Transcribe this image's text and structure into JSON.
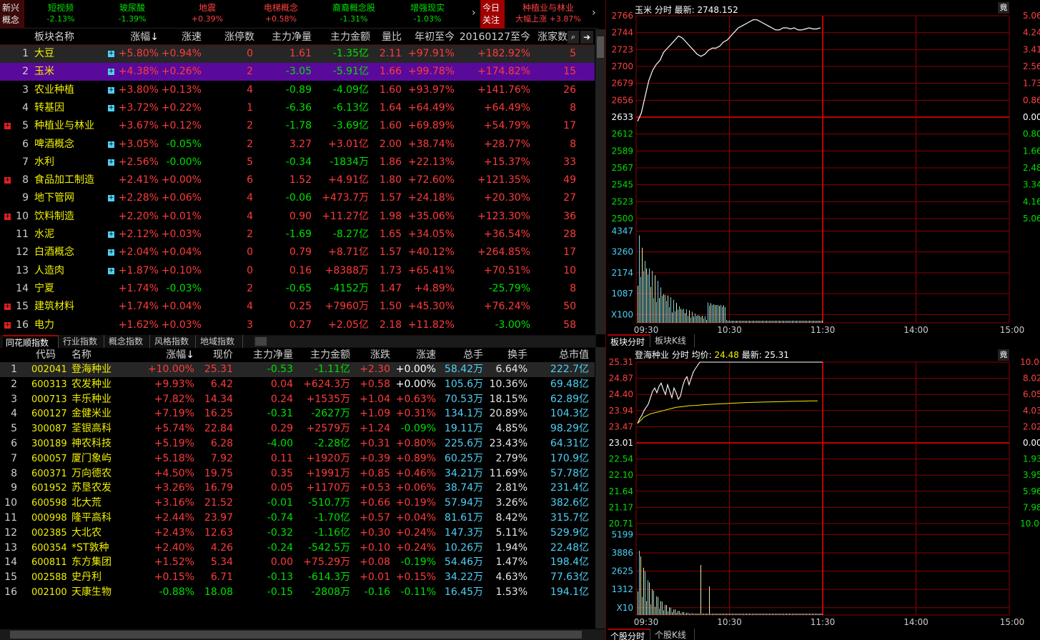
{
  "ticker": {
    "left_label_1": "新兴",
    "left_label_2": "概念",
    "items": [
      {
        "name": "短视频",
        "value": "-2.13%",
        "name_color": "green",
        "value_color": "green"
      },
      {
        "name": "玻尿酸",
        "value": "-1.39%",
        "name_color": "green",
        "value_color": "green"
      },
      {
        "name": "地震",
        "value": "+0.39%",
        "name_color": "red",
        "value_color": "red"
      },
      {
        "name": "电梯概念",
        "value": "+0.58%",
        "name_color": "red",
        "value_color": "red"
      },
      {
        "name": "裔裔概念股",
        "value": "-1.31%",
        "name_color": "green",
        "value_color": "green"
      },
      {
        "name": "增强现实",
        "value": "-1.03%",
        "name_color": "green",
        "value_color": "green"
      }
    ],
    "arrow": "›",
    "focus_label_1": "今日",
    "focus_label_2": "关注",
    "focus_item_title": "种植业与林业",
    "focus_item_desc": "大幅上涨 +3.87%"
  },
  "sector_table": {
    "columns": [
      "板块名称",
      "涨幅",
      "涨速",
      "涨停数",
      "主力净量",
      "主力金额",
      "量比",
      "年初至今",
      "20160127至今",
      "涨家数"
    ],
    "sort_arrow": "↓",
    "rows": [
      {
        "i": "1",
        "name": "大豆",
        "icon": "cyan",
        "chg": "+5.80%",
        "spd": "+0.94%",
        "lim": "0",
        "net": "1.61",
        "amt": "-1.35亿",
        "vr": "2.11",
        "ytd": "+97.91%",
        "since": "+182.92%",
        "ups": "5"
      },
      {
        "i": "2",
        "name": "玉米",
        "icon": "cyan",
        "chg": "+4.38%",
        "spd": "+0.26%",
        "lim": "2",
        "net": "-3.05",
        "amt": "-5.91亿",
        "vr": "1.66",
        "ytd": "+99.78%",
        "since": "+174.82%",
        "ups": "15"
      },
      {
        "i": "3",
        "name": "农业种植",
        "icon": "cyan",
        "chg": "+3.80%",
        "spd": "+0.13%",
        "lim": "4",
        "net": "-0.89",
        "amt": "-4.09亿",
        "vr": "1.60",
        "ytd": "+93.97%",
        "since": "+141.76%",
        "ups": "26"
      },
      {
        "i": "4",
        "name": "转基因",
        "icon": "cyan",
        "chg": "+3.72%",
        "spd": "+0.22%",
        "lim": "1",
        "net": "-6.36",
        "amt": "-6.13亿",
        "vr": "1.64",
        "ytd": "+64.49%",
        "since": "+64.49%",
        "ups": "8"
      },
      {
        "i": "5",
        "name": "种植业与林业",
        "icon": "red",
        "chg": "+3.67%",
        "spd": "+0.12%",
        "lim": "2",
        "net": "-1.78",
        "amt": "-3.69亿",
        "vr": "1.60",
        "ytd": "+69.89%",
        "since": "+54.79%",
        "ups": "17"
      },
      {
        "i": "6",
        "name": "啤酒概念",
        "icon": "cyan",
        "chg": "+3.05%",
        "spd": "-0.05%",
        "lim": "2",
        "net": "3.27",
        "amt": "+3.01亿",
        "vr": "2.00",
        "ytd": "+38.74%",
        "since": "+28.77%",
        "ups": "8"
      },
      {
        "i": "7",
        "name": "水利",
        "icon": "cyan",
        "chg": "+2.56%",
        "spd": "-0.00%",
        "lim": "5",
        "net": "-0.34",
        "amt": "-1834万",
        "vr": "1.86",
        "ytd": "+22.13%",
        "since": "+15.37%",
        "ups": "33"
      },
      {
        "i": "8",
        "name": "食品加工制造",
        "icon": "red",
        "chg": "+2.41%",
        "spd": "+0.00%",
        "lim": "6",
        "net": "1.52",
        "amt": "+4.91亿",
        "vr": "1.80",
        "ytd": "+72.60%",
        "since": "+121.35%",
        "ups": "49"
      },
      {
        "i": "9",
        "name": "地下管网",
        "icon": "cyan",
        "chg": "+2.28%",
        "spd": "+0.06%",
        "lim": "4",
        "net": "-0.06",
        "amt": "+473.7万",
        "vr": "1.57",
        "ytd": "+24.18%",
        "since": "+20.30%",
        "ups": "27"
      },
      {
        "i": "10",
        "name": "饮料制造",
        "icon": "red",
        "chg": "+2.20%",
        "spd": "+0.01%",
        "lim": "4",
        "net": "0.90",
        "amt": "+11.27亿",
        "vr": "1.98",
        "ytd": "+35.06%",
        "since": "+123.30%",
        "ups": "36"
      },
      {
        "i": "11",
        "name": "水泥",
        "icon": "cyan",
        "chg": "+2.12%",
        "spd": "+0.03%",
        "lim": "2",
        "net": "-1.69",
        "amt": "-8.27亿",
        "vr": "1.65",
        "ytd": "+34.05%",
        "since": "+36.54%",
        "ups": "28"
      },
      {
        "i": "12",
        "name": "白酒概念",
        "icon": "cyan",
        "chg": "+2.04%",
        "spd": "+0.04%",
        "lim": "0",
        "net": "0.79",
        "amt": "+8.71亿",
        "vr": "1.57",
        "ytd": "+40.12%",
        "since": "+264.85%",
        "ups": "17"
      },
      {
        "i": "13",
        "name": "人造肉",
        "icon": "cyan",
        "chg": "+1.87%",
        "spd": "+0.10%",
        "lim": "0",
        "net": "0.16",
        "amt": "+8388万",
        "vr": "1.73",
        "ytd": "+65.41%",
        "since": "+70.51%",
        "ups": "10"
      },
      {
        "i": "14",
        "name": "宁夏",
        "icon": "",
        "chg": "+1.74%",
        "spd": "-0.03%",
        "lim": "2",
        "net": "-0.65",
        "amt": "-4152万",
        "vr": "1.47",
        "ytd": "+4.89%",
        "since": "-25.79%",
        "ups": "8"
      },
      {
        "i": "15",
        "name": "建筑材料",
        "icon": "red",
        "chg": "+1.74%",
        "spd": "+0.04%",
        "lim": "4",
        "net": "0.25",
        "amt": "+7960万",
        "vr": "1.50",
        "ytd": "+45.30%",
        "since": "+76.24%",
        "ups": "50"
      },
      {
        "i": "16",
        "name": "电力",
        "icon": "red",
        "chg": "+1.62%",
        "spd": "+0.03%",
        "lim": "3",
        "net": "0.27",
        "amt": "+2.05亿",
        "vr": "2.18",
        "ytd": "+11.82%",
        "since": "-3.00%",
        "ups": "58"
      }
    ]
  },
  "index_tabs": [
    "同花顺指数",
    "行业指数",
    "概念指数",
    "风格指数",
    "地域指数"
  ],
  "stock_table": {
    "columns": [
      "代码",
      "名称",
      "涨幅",
      "现价",
      "主力净量",
      "主力金额",
      "涨跌",
      "涨速",
      "总手",
      "换手",
      "总市值"
    ],
    "rows": [
      {
        "i": "1",
        "code": "002041",
        "name": "登海种业",
        "chg": "+10.00%",
        "price": "25.31",
        "net": "-0.53",
        "amt": "-1.11亿",
        "diff": "+2.30",
        "spd": "+0.00%",
        "vol": "58.42万",
        "turn": "6.64%",
        "cap": "222.7亿"
      },
      {
        "i": "2",
        "code": "600313",
        "name": "农发种业",
        "chg": "+9.93%",
        "price": "6.42",
        "net": "0.04",
        "amt": "+624.3万",
        "diff": "+0.58",
        "spd": "+0.00%",
        "vol": "105.6万",
        "turn": "10.36%",
        "cap": "69.48亿"
      },
      {
        "i": "3",
        "code": "000713",
        "name": "丰乐种业",
        "chg": "+7.82%",
        "price": "14.34",
        "net": "0.24",
        "amt": "+1535万",
        "diff": "+1.04",
        "spd": "+0.63%",
        "vol": "70.53万",
        "turn": "18.15%",
        "cap": "62.89亿"
      },
      {
        "i": "4",
        "code": "600127",
        "name": "金健米业",
        "chg": "+7.19%",
        "price": "16.25",
        "net": "-0.31",
        "amt": "-2627万",
        "diff": "+1.09",
        "spd": "+0.31%",
        "vol": "134.1万",
        "turn": "20.89%",
        "cap": "104.3亿"
      },
      {
        "i": "5",
        "code": "300087",
        "name": "荃银高科",
        "chg": "+5.74%",
        "price": "22.84",
        "net": "0.29",
        "amt": "+2579万",
        "diff": "+1.24",
        "spd": "-0.09%",
        "vol": "19.11万",
        "turn": "4.85%",
        "cap": "98.29亿"
      },
      {
        "i": "6",
        "code": "300189",
        "name": "神农科技",
        "chg": "+5.19%",
        "price": "6.28",
        "net": "-4.00",
        "amt": "-2.28亿",
        "diff": "+0.31",
        "spd": "+0.80%",
        "vol": "225.6万",
        "turn": "23.43%",
        "cap": "64.31亿"
      },
      {
        "i": "7",
        "code": "600057",
        "name": "厦门象屿",
        "chg": "+5.18%",
        "price": "7.92",
        "net": "0.11",
        "amt": "+1920万",
        "diff": "+0.39",
        "spd": "+0.89%",
        "vol": "60.25万",
        "turn": "2.79%",
        "cap": "170.9亿"
      },
      {
        "i": "8",
        "code": "600371",
        "name": "万向德农",
        "chg": "+4.50%",
        "price": "19.75",
        "net": "0.35",
        "amt": "+1991万",
        "diff": "+0.85",
        "spd": "+0.46%",
        "vol": "34.21万",
        "turn": "11.69%",
        "cap": "57.78亿"
      },
      {
        "i": "9",
        "code": "601952",
        "name": "苏垦农发",
        "chg": "+3.26%",
        "price": "16.79",
        "net": "0.05",
        "amt": "+1170万",
        "diff": "+0.53",
        "spd": "+0.06%",
        "vol": "38.74万",
        "turn": "2.81%",
        "cap": "231.4亿"
      },
      {
        "i": "10",
        "code": "600598",
        "name": "北大荒",
        "chg": "+3.16%",
        "price": "21.52",
        "net": "-0.01",
        "amt": "-510.7万",
        "diff": "+0.66",
        "spd": "+0.19%",
        "vol": "57.94万",
        "turn": "3.26%",
        "cap": "382.6亿"
      },
      {
        "i": "11",
        "code": "000998",
        "name": "隆平高科",
        "chg": "+2.44%",
        "price": "23.97",
        "net": "-0.74",
        "amt": "-1.70亿",
        "diff": "+0.57",
        "spd": "+0.04%",
        "vol": "81.61万",
        "turn": "8.42%",
        "cap": "315.7亿"
      },
      {
        "i": "12",
        "code": "002385",
        "name": "大北农",
        "chg": "+2.43%",
        "price": "12.63",
        "net": "-0.32",
        "amt": "-1.16亿",
        "diff": "+0.30",
        "spd": "+0.24%",
        "vol": "147.3万",
        "turn": "5.11%",
        "cap": "529.9亿"
      },
      {
        "i": "13",
        "code": "600354",
        "name": "*ST敦种",
        "chg": "+2.40%",
        "price": "4.26",
        "net": "-0.24",
        "amt": "-542.5万",
        "diff": "+0.10",
        "spd": "+0.24%",
        "vol": "10.26万",
        "turn": "1.94%",
        "cap": "22.48亿"
      },
      {
        "i": "14",
        "code": "600811",
        "name": "东方集团",
        "chg": "+1.52%",
        "price": "5.34",
        "net": "0.00",
        "amt": "+75.29万",
        "diff": "+0.08",
        "spd": "-0.19%",
        "vol": "54.46万",
        "turn": "1.47%",
        "cap": "198.4亿"
      },
      {
        "i": "15",
        "code": "002588",
        "name": "史丹利",
        "chg": "+0.15%",
        "price": "6.71",
        "net": "-0.13",
        "amt": "-614.3万",
        "diff": "+0.01",
        "spd": "+0.15%",
        "vol": "34.22万",
        "turn": "4.63%",
        "cap": "77.63亿"
      },
      {
        "i": "16",
        "code": "002100",
        "name": "天康生物",
        "chg": "-0.88%",
        "price": "18.08",
        "net": "-0.15",
        "amt": "-2808万",
        "diff": "-0.16",
        "spd": "-0.11%",
        "vol": "16.45万",
        "turn": "1.53%",
        "cap": "194.1亿"
      }
    ]
  },
  "chart_top": {
    "title": "玉米  分时  最新: 2748.152",
    "corner": "竟",
    "left_ticks": [
      "2766",
      "2744",
      "2723",
      "2700",
      "2679",
      "2656",
      "2633",
      "2612",
      "2589",
      "2567",
      "2545",
      "2523",
      "2500"
    ],
    "right_ticks": [
      "5.06%",
      "4.24%",
      "3.41%",
      "2.56%",
      "1.73%",
      "0.86%",
      "0.00%",
      "0.80%",
      "1.66%",
      "2.48%",
      "3.34%",
      "4.16%",
      "5.06%"
    ],
    "vol_ticks": [
      "4347",
      "3260",
      "2174",
      "1087",
      "X100"
    ],
    "x_labels": [
      "09:30",
      "10:30",
      "11:30",
      "14:00",
      "15:00"
    ],
    "tabs": [
      "板块分时",
      "板块K线"
    ]
  },
  "chart_bottom": {
    "title_name": "登海种业",
    "title_mid": "分时  均价: ",
    "avg": "24.48",
    "latest_label": "  最新: ",
    "latest": "25.31",
    "corner": "竟",
    "left_ticks": [
      "25.31",
      "24.87",
      "24.40",
      "23.94",
      "23.47",
      "23.01",
      "22.54",
      "22.10",
      "21.64",
      "21.17",
      "20.71"
    ],
    "right_ticks": [
      "10.00%",
      "8.02%",
      "6.05%",
      "4.03%",
      "2.02%",
      "0.00%",
      "1.93%",
      "3.95%",
      "5.96%",
      "7.98%",
      "10.00%"
    ],
    "vol_ticks": [
      "5199",
      "3886",
      "2625",
      "1312",
      "X10"
    ],
    "x_labels": [
      "09:30",
      "10:30",
      "11:30",
      "14:00",
      "15:00"
    ],
    "tabs": [
      "个股分时",
      "个股K线"
    ]
  },
  "colors": {
    "up": "#ff3b3b",
    "down": "#00e000",
    "name": "#f0f000",
    "cyan": "#4fd0f5",
    "grid": "#8a0000"
  }
}
